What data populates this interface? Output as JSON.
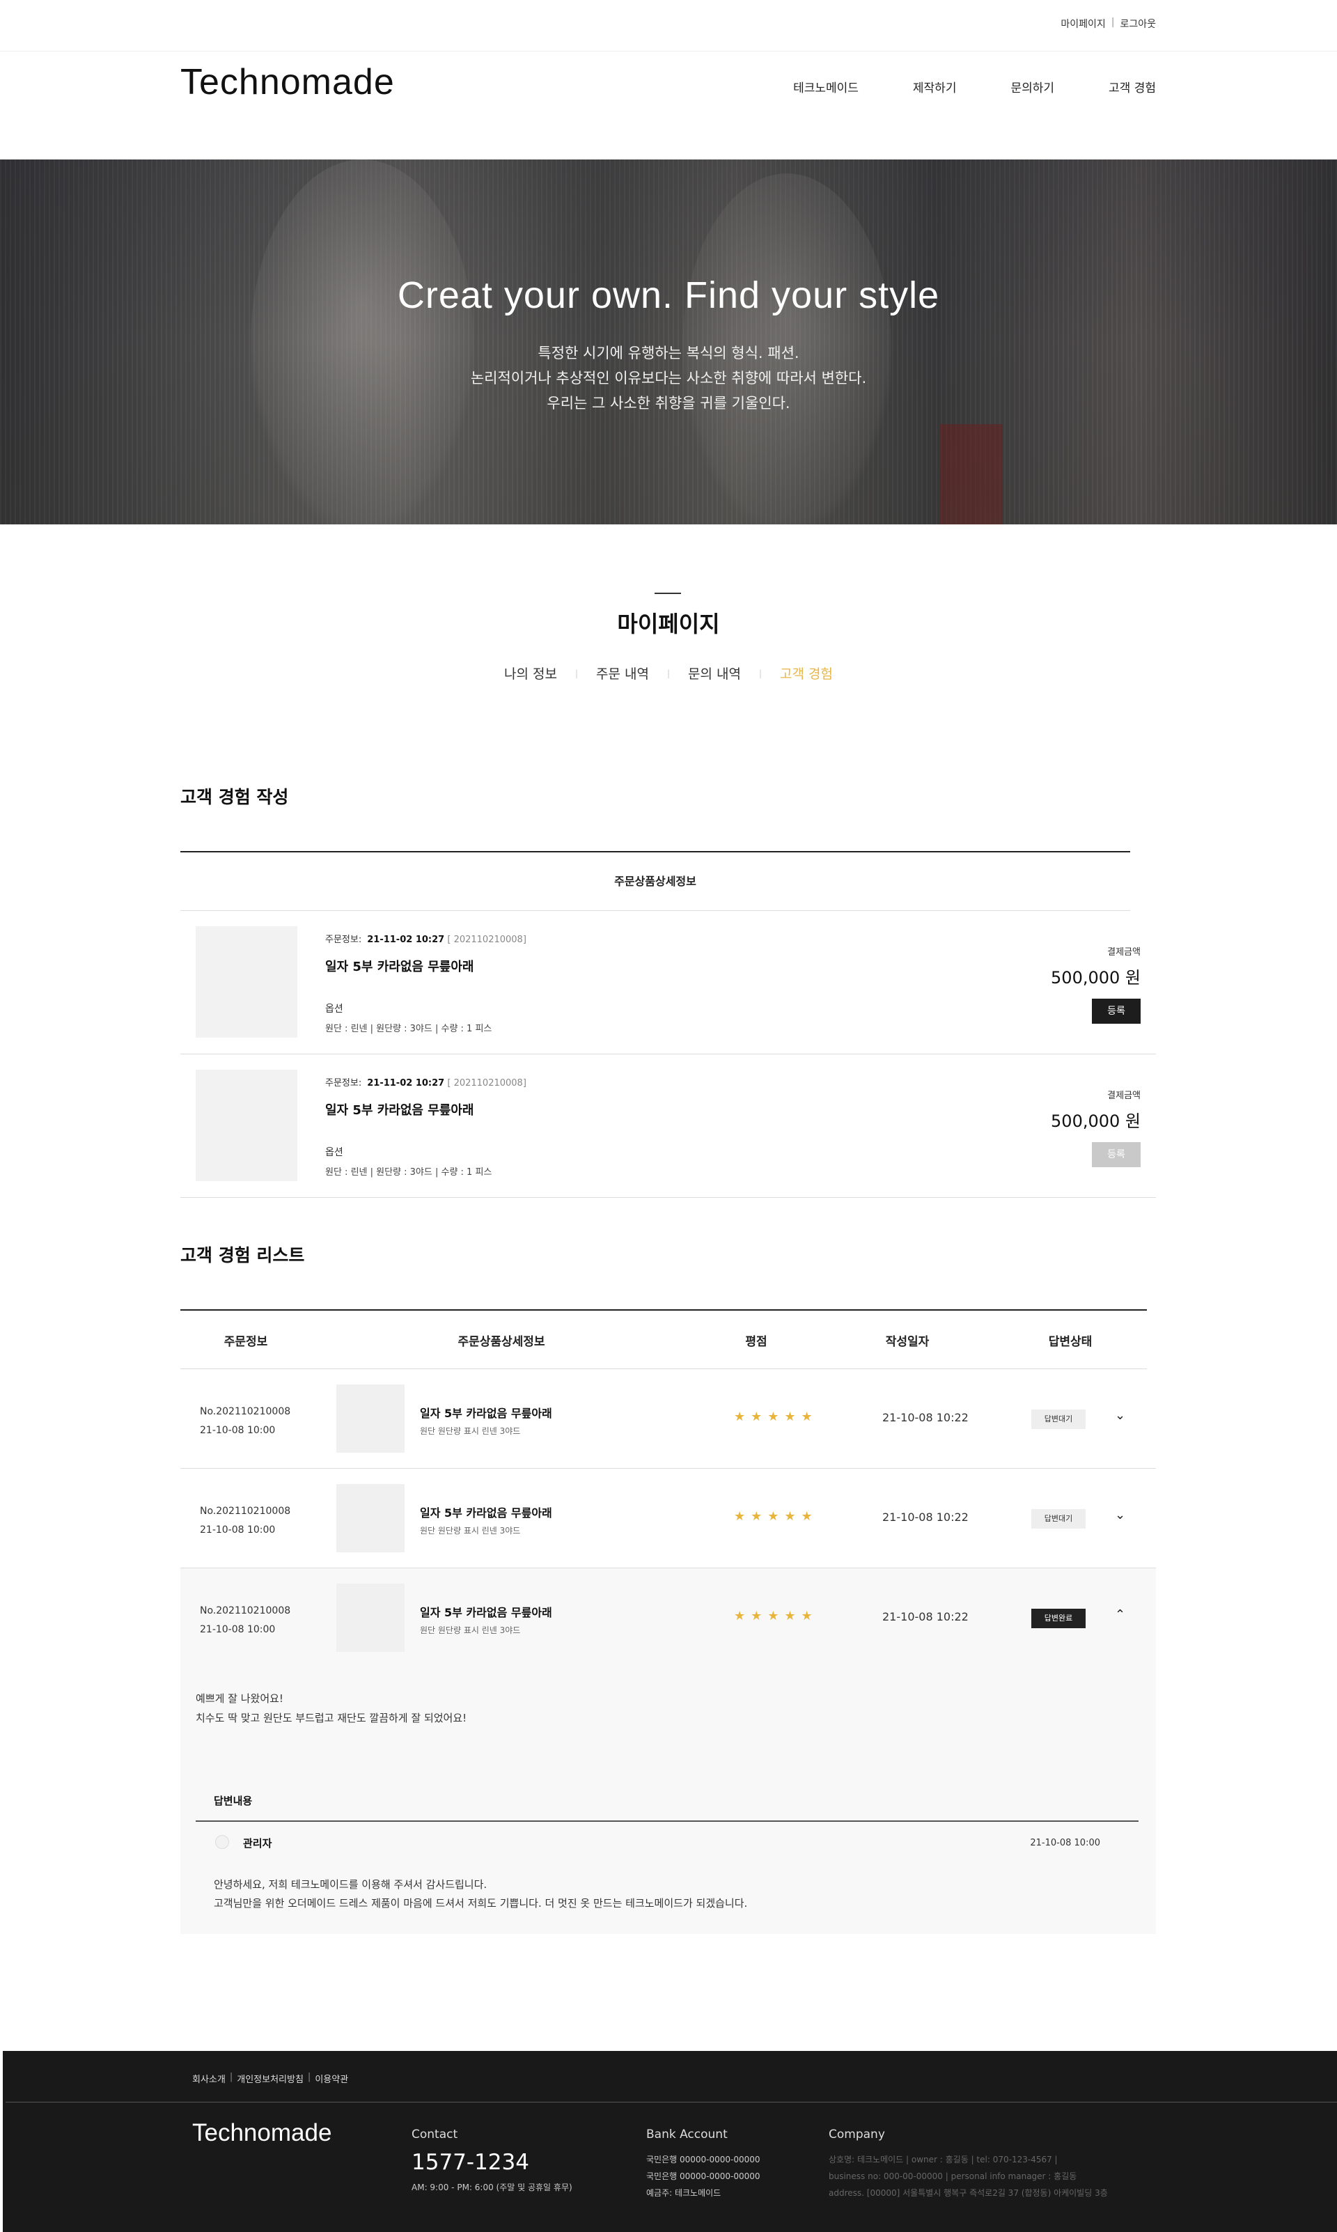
{
  "topbar": {
    "mypage": "마이페이지",
    "sep": "|",
    "logout": "로그아웃"
  },
  "header": {
    "logo": "Technomade",
    "nav": [
      "테크노메이드",
      "제작하기",
      "문의하기",
      "고객 경험"
    ]
  },
  "hero": {
    "title": "Creat your own. Find your style",
    "lines": [
      "특정한 시기에 유행하는 복식의 형식. 패션.",
      "논리적이거나 추상적인 이유보다는 사소한 취향에 따라서 변한다.",
      "우리는 그 사소한 취향을 귀를 기울인다."
    ]
  },
  "mypage": {
    "title": "마이페이지",
    "tabs": [
      "나의 정보",
      "주문 내역",
      "문의 내역",
      "고객 경험"
    ],
    "active_tab": "고객 경험"
  },
  "write_section": {
    "title": "고객 경험 작성",
    "header": "주문상품상세정보",
    "orders": [
      {
        "info_label": "주문정보:",
        "datetime": "21-11-02 10:27",
        "order_no": "[ 202110210008]",
        "product": "일자 5부 카라없음 무릎아래",
        "option_label": "옵션",
        "option_value": "원단 : 린넨  | 원단량 : 3야드  |  수량 : 1 피스",
        "pay_label": "결제금액",
        "price": "500,000 원",
        "button": "등록",
        "button_enabled": true
      },
      {
        "info_label": "주문정보:",
        "datetime": "21-11-02 10:27",
        "order_no": "[ 202110210008]",
        "product": "일자 5부 카라없음 무릎아래",
        "option_label": "옵션",
        "option_value": "원단 : 린넨  | 원단량 : 3야드  |  수량 : 1 피스",
        "pay_label": "결제금액",
        "price": "500,000 원",
        "button": "등록",
        "button_enabled": false
      }
    ]
  },
  "list_section": {
    "title": "고객 경험 리스트",
    "columns": [
      "주문정보",
      "주문상품상세정보",
      "평점",
      "작성일자",
      "답변상태"
    ],
    "rows": [
      {
        "order_no": "No.202110210008",
        "order_date": "21-10-08  10:00",
        "product": "일자 5부 카라없음 무릎아래",
        "option": "원단  원단량 표시 린넨 3야드",
        "stars": "★★★★★",
        "rating": 5,
        "written": "21-10-08 10:22",
        "status": "답변대기",
        "chevron": "⌄"
      },
      {
        "order_no": "No.202110210008",
        "order_date": "21-10-08  10:00",
        "product": "일자 5부 카라없음 무릎아래",
        "option": "원단  원단량 표시 린넨 3야드",
        "stars": "★★★★★",
        "rating": 5,
        "written": "21-10-08 10:22",
        "status": "답변대기",
        "chevron": "⌄"
      },
      {
        "order_no": "No.202110210008",
        "order_date": "21-10-08  10:00",
        "product": "일자 5부 카라없음 무릎아래",
        "option": "원단  원단량 표시 린넨 3야드",
        "stars": "★★★★★",
        "rating": 5,
        "written": "21-10-08 10:22",
        "status": "답변완료",
        "chevron": "⌃"
      }
    ],
    "expanded": {
      "review_lines": [
        "예쁘게 잘 나왔어요!",
        "치수도 딱 맞고 원단도 부드럽고 재단도 깔끔하게 잘 되었어요!"
      ],
      "answer_title": "답변내용",
      "admin_name": "관리자",
      "answer_date": "21-10-08  10:00",
      "answer_lines": [
        "안녕하세요, 저희 테크노메이드를 이용해 주셔서 감사드립니다.",
        "고객님만을 위한 오더메이드 드레스 제품이 마음에 드셔서 저희도 기쁩니다. 더 멋진 옷 만드는 테크노메이드가 되겠습니다."
      ]
    }
  },
  "footer": {
    "links": [
      "회사소개",
      "개인정보처리방침",
      "이용약관"
    ],
    "sep": "|",
    "logo": "Technomade",
    "contact": {
      "title": "Contact",
      "phone": "1577-1234",
      "hours": "AM: 9:00 - PM: 6:00 (주말 및 공휴일 휴무)"
    },
    "bank": {
      "title": "Bank Account",
      "lines": [
        "국민은행 00000-0000-00000",
        "국민은행 00000-0000-00000",
        "예금주:    테크노메이드"
      ]
    },
    "company": {
      "title": "Company",
      "lines": [
        "상호명: 테크노메이드 |  owner : 홍길동  |  tel: 070-123-4567 |",
        "business no: 000-00-00000 | personal info manager : 홍길동",
        "address. [00000] 서울특별시 행복구 즉석로2길 37 (합정동) 아케이빌딩 3층"
      ]
    }
  },
  "colors": {
    "accent": "#e9b545",
    "dark": "#1d1d1d",
    "footer_bg": "#191919"
  }
}
